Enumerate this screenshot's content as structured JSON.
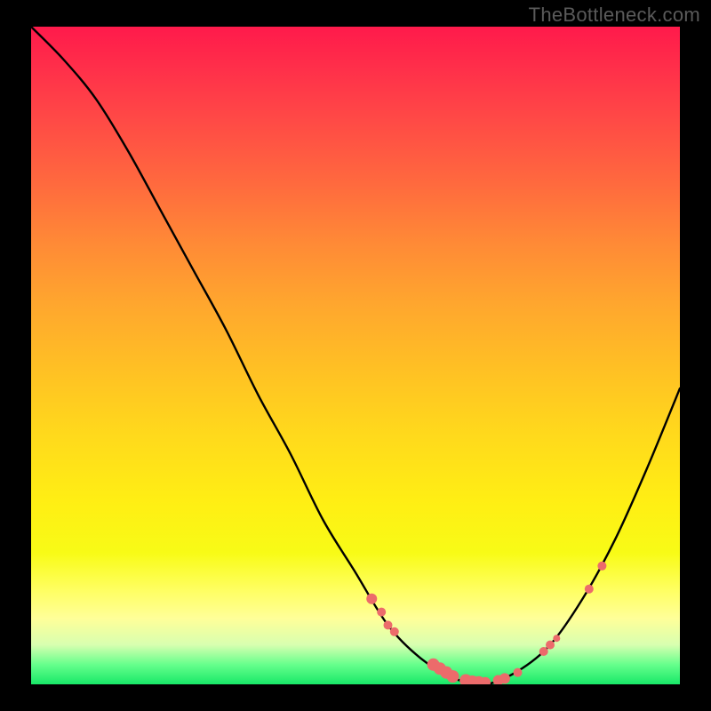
{
  "watermark": "TheBottleneck.com",
  "colors": {
    "background": "#000000",
    "curve": "#000000",
    "marker": "#ec6b6b"
  },
  "chart_data": {
    "type": "line",
    "title": "",
    "xlabel": "",
    "ylabel": "",
    "xlim": [
      0,
      100
    ],
    "ylim": [
      0,
      100
    ],
    "curve": [
      {
        "x": 0,
        "y": 100
      },
      {
        "x": 5,
        "y": 95
      },
      {
        "x": 10,
        "y": 89
      },
      {
        "x": 15,
        "y": 81
      },
      {
        "x": 20,
        "y": 72
      },
      {
        "x": 25,
        "y": 63
      },
      {
        "x": 30,
        "y": 54
      },
      {
        "x": 35,
        "y": 44
      },
      {
        "x": 40,
        "y": 35
      },
      {
        "x": 45,
        "y": 25
      },
      {
        "x": 50,
        "y": 17
      },
      {
        "x": 55,
        "y": 9
      },
      {
        "x": 60,
        "y": 4
      },
      {
        "x": 65,
        "y": 1
      },
      {
        "x": 70,
        "y": 0
      },
      {
        "x": 75,
        "y": 2
      },
      {
        "x": 80,
        "y": 6
      },
      {
        "x": 85,
        "y": 13
      },
      {
        "x": 90,
        "y": 22
      },
      {
        "x": 95,
        "y": 33
      },
      {
        "x": 100,
        "y": 45
      }
    ],
    "markers": [
      {
        "x": 52.5,
        "y": 13,
        "r": 6
      },
      {
        "x": 54,
        "y": 11,
        "r": 5
      },
      {
        "x": 55,
        "y": 9,
        "r": 5
      },
      {
        "x": 56,
        "y": 8,
        "r": 5
      },
      {
        "x": 62,
        "y": 3,
        "r": 7
      },
      {
        "x": 63,
        "y": 2.4,
        "r": 7
      },
      {
        "x": 64,
        "y": 1.8,
        "r": 7
      },
      {
        "x": 65,
        "y": 1.2,
        "r": 7
      },
      {
        "x": 67,
        "y": 0.6,
        "r": 7
      },
      {
        "x": 68,
        "y": 0.4,
        "r": 7
      },
      {
        "x": 69,
        "y": 0.3,
        "r": 7
      },
      {
        "x": 70,
        "y": 0.3,
        "r": 6
      },
      {
        "x": 72,
        "y": 0.6,
        "r": 6
      },
      {
        "x": 73,
        "y": 0.9,
        "r": 6
      },
      {
        "x": 75,
        "y": 1.8,
        "r": 5
      },
      {
        "x": 79,
        "y": 5,
        "r": 5
      },
      {
        "x": 80,
        "y": 6,
        "r": 5
      },
      {
        "x": 81,
        "y": 7,
        "r": 4
      },
      {
        "x": 86,
        "y": 14.5,
        "r": 5
      },
      {
        "x": 88,
        "y": 18,
        "r": 5
      }
    ]
  }
}
